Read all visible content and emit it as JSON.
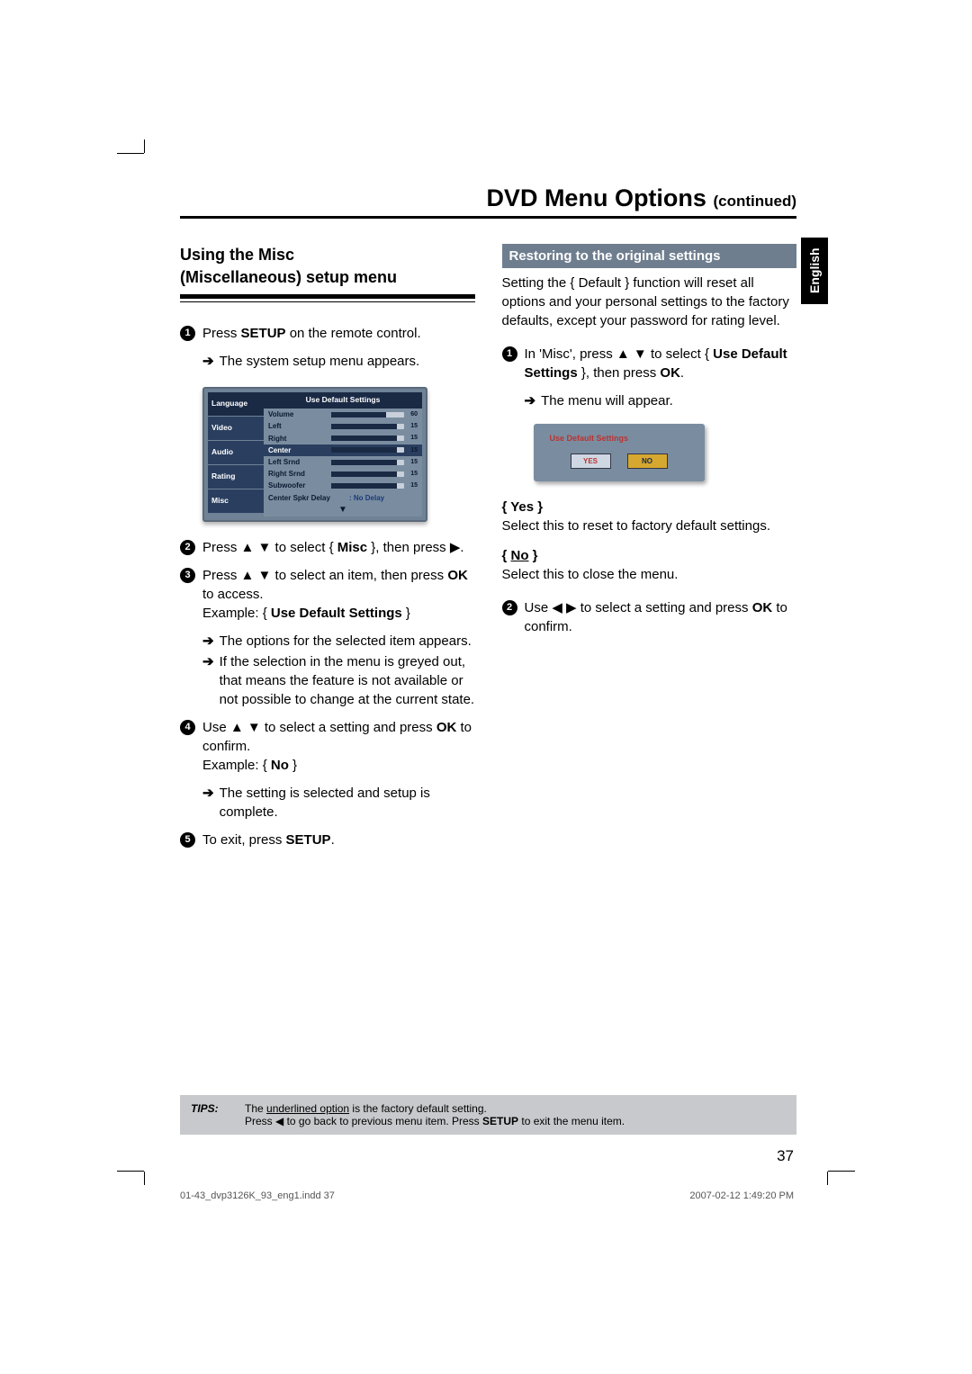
{
  "header": {
    "title": "DVD Menu Options",
    "continued": "(continued)"
  },
  "langTab": "English",
  "left": {
    "heading1": "Using the Misc",
    "heading2": "(Miscellaneous) setup menu",
    "step1a": "Press ",
    "step1b": "SETUP",
    "step1c": " on the remote control.",
    "step1sub": "The system setup menu appears.",
    "menu": {
      "tabs": [
        "Language",
        "Video",
        "Audio",
        "Rating",
        "Misc"
      ],
      "head": "Use Default Settings",
      "rows": [
        {
          "label": "Volume",
          "val": "60",
          "fill": 75
        },
        {
          "label": "Left",
          "val": "15",
          "fill": 90
        },
        {
          "label": "Right",
          "val": "15",
          "fill": 90
        },
        {
          "label": "Center",
          "val": "15",
          "fill": 90,
          "hl": true
        },
        {
          "label": "Left Srnd",
          "val": "15",
          "fill": 90
        },
        {
          "label": "Right Srnd",
          "val": "15",
          "fill": 90
        },
        {
          "label": "Subwoofer",
          "val": "15",
          "fill": 90
        }
      ],
      "delayLabel": "Center Spkr Delay",
      "delayVal": ": No Delay"
    },
    "step2a": "Press ▲ ▼ to select { ",
    "step2b": "Misc",
    "step2c": " }, then press ▶.",
    "step3a": "Press ▲ ▼ to select an item, then press ",
    "step3b": "OK",
    "step3c": " to access.",
    "step3ex1": "Example: { ",
    "step3ex2": "Use Default Settings",
    "step3ex3": " }",
    "step3sub1": "The options for the selected item appears.",
    "step3sub2": "If the selection in the menu is greyed out, that means the feature is not available or not possible to change at the current state.",
    "step4a": "Use ▲ ▼ to select a setting and press ",
    "step4b": "OK",
    "step4c": " to confirm.",
    "step4ex1": "Example: { ",
    "step4ex2": "No",
    "step4ex3": " }",
    "step4sub": "The setting is selected and setup is complete.",
    "step5a": "To exit, press ",
    "step5b": "SETUP",
    "step5c": "."
  },
  "right": {
    "subheading": "Restoring to the original settings",
    "intro": "Setting the { Default } function will reset all options and your personal settings to the factory defaults, except your password for rating level.",
    "step1a": "In 'Misc', press ▲ ▼ to select { ",
    "step1b": "Use Default Settings",
    "step1c": " }, then press ",
    "step1d": "OK",
    "step1e": ".",
    "step1sub": "The menu will appear.",
    "dialog": {
      "title": "Use Default Settings",
      "yes": "YES",
      "no": "NO"
    },
    "yesLabel": "{ Yes }",
    "yesText": "Select this to reset to factory default settings.",
    "noLabel": "{ No }",
    "noText": "Select this to close the menu.",
    "step2a": "Use ◀ ▶ to select a setting and press ",
    "step2b": "OK",
    "step2c": " to confirm."
  },
  "tips": {
    "label": "TIPS:",
    "line1a": "The ",
    "line1b": "underlined option",
    "line1c": " is the factory default setting.",
    "line2a": "Press ◀ to go back to previous menu item. Press ",
    "line2b": "SETUP",
    "line2c": " to exit the menu item."
  },
  "pageNumber": "37",
  "footer": {
    "left": "01-43_dvp3126K_93_eng1.indd   37",
    "right": "2007-02-12   1:49:20 PM"
  }
}
